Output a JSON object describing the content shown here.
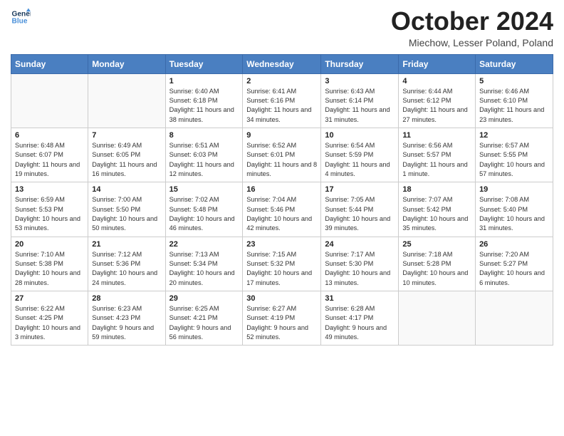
{
  "header": {
    "logo_line1": "General",
    "logo_line2": "Blue",
    "month_title": "October 2024",
    "subtitle": "Miechow, Lesser Poland, Poland"
  },
  "days_of_week": [
    "Sunday",
    "Monday",
    "Tuesday",
    "Wednesday",
    "Thursday",
    "Friday",
    "Saturday"
  ],
  "weeks": [
    [
      {
        "day": "",
        "sunrise": "",
        "sunset": "",
        "daylight": ""
      },
      {
        "day": "",
        "sunrise": "",
        "sunset": "",
        "daylight": ""
      },
      {
        "day": "1",
        "sunrise": "Sunrise: 6:40 AM",
        "sunset": "Sunset: 6:18 PM",
        "daylight": "Daylight: 11 hours and 38 minutes."
      },
      {
        "day": "2",
        "sunrise": "Sunrise: 6:41 AM",
        "sunset": "Sunset: 6:16 PM",
        "daylight": "Daylight: 11 hours and 34 minutes."
      },
      {
        "day": "3",
        "sunrise": "Sunrise: 6:43 AM",
        "sunset": "Sunset: 6:14 PM",
        "daylight": "Daylight: 11 hours and 31 minutes."
      },
      {
        "day": "4",
        "sunrise": "Sunrise: 6:44 AM",
        "sunset": "Sunset: 6:12 PM",
        "daylight": "Daylight: 11 hours and 27 minutes."
      },
      {
        "day": "5",
        "sunrise": "Sunrise: 6:46 AM",
        "sunset": "Sunset: 6:10 PM",
        "daylight": "Daylight: 11 hours and 23 minutes."
      }
    ],
    [
      {
        "day": "6",
        "sunrise": "Sunrise: 6:48 AM",
        "sunset": "Sunset: 6:07 PM",
        "daylight": "Daylight: 11 hours and 19 minutes."
      },
      {
        "day": "7",
        "sunrise": "Sunrise: 6:49 AM",
        "sunset": "Sunset: 6:05 PM",
        "daylight": "Daylight: 11 hours and 16 minutes."
      },
      {
        "day": "8",
        "sunrise": "Sunrise: 6:51 AM",
        "sunset": "Sunset: 6:03 PM",
        "daylight": "Daylight: 11 hours and 12 minutes."
      },
      {
        "day": "9",
        "sunrise": "Sunrise: 6:52 AM",
        "sunset": "Sunset: 6:01 PM",
        "daylight": "Daylight: 11 hours and 8 minutes."
      },
      {
        "day": "10",
        "sunrise": "Sunrise: 6:54 AM",
        "sunset": "Sunset: 5:59 PM",
        "daylight": "Daylight: 11 hours and 4 minutes."
      },
      {
        "day": "11",
        "sunrise": "Sunrise: 6:56 AM",
        "sunset": "Sunset: 5:57 PM",
        "daylight": "Daylight: 11 hours and 1 minute."
      },
      {
        "day": "12",
        "sunrise": "Sunrise: 6:57 AM",
        "sunset": "Sunset: 5:55 PM",
        "daylight": "Daylight: 10 hours and 57 minutes."
      }
    ],
    [
      {
        "day": "13",
        "sunrise": "Sunrise: 6:59 AM",
        "sunset": "Sunset: 5:53 PM",
        "daylight": "Daylight: 10 hours and 53 minutes."
      },
      {
        "day": "14",
        "sunrise": "Sunrise: 7:00 AM",
        "sunset": "Sunset: 5:50 PM",
        "daylight": "Daylight: 10 hours and 50 minutes."
      },
      {
        "day": "15",
        "sunrise": "Sunrise: 7:02 AM",
        "sunset": "Sunset: 5:48 PM",
        "daylight": "Daylight: 10 hours and 46 minutes."
      },
      {
        "day": "16",
        "sunrise": "Sunrise: 7:04 AM",
        "sunset": "Sunset: 5:46 PM",
        "daylight": "Daylight: 10 hours and 42 minutes."
      },
      {
        "day": "17",
        "sunrise": "Sunrise: 7:05 AM",
        "sunset": "Sunset: 5:44 PM",
        "daylight": "Daylight: 10 hours and 39 minutes."
      },
      {
        "day": "18",
        "sunrise": "Sunrise: 7:07 AM",
        "sunset": "Sunset: 5:42 PM",
        "daylight": "Daylight: 10 hours and 35 minutes."
      },
      {
        "day": "19",
        "sunrise": "Sunrise: 7:08 AM",
        "sunset": "Sunset: 5:40 PM",
        "daylight": "Daylight: 10 hours and 31 minutes."
      }
    ],
    [
      {
        "day": "20",
        "sunrise": "Sunrise: 7:10 AM",
        "sunset": "Sunset: 5:38 PM",
        "daylight": "Daylight: 10 hours and 28 minutes."
      },
      {
        "day": "21",
        "sunrise": "Sunrise: 7:12 AM",
        "sunset": "Sunset: 5:36 PM",
        "daylight": "Daylight: 10 hours and 24 minutes."
      },
      {
        "day": "22",
        "sunrise": "Sunrise: 7:13 AM",
        "sunset": "Sunset: 5:34 PM",
        "daylight": "Daylight: 10 hours and 20 minutes."
      },
      {
        "day": "23",
        "sunrise": "Sunrise: 7:15 AM",
        "sunset": "Sunset: 5:32 PM",
        "daylight": "Daylight: 10 hours and 17 minutes."
      },
      {
        "day": "24",
        "sunrise": "Sunrise: 7:17 AM",
        "sunset": "Sunset: 5:30 PM",
        "daylight": "Daylight: 10 hours and 13 minutes."
      },
      {
        "day": "25",
        "sunrise": "Sunrise: 7:18 AM",
        "sunset": "Sunset: 5:28 PM",
        "daylight": "Daylight: 10 hours and 10 minutes."
      },
      {
        "day": "26",
        "sunrise": "Sunrise: 7:20 AM",
        "sunset": "Sunset: 5:27 PM",
        "daylight": "Daylight: 10 hours and 6 minutes."
      }
    ],
    [
      {
        "day": "27",
        "sunrise": "Sunrise: 6:22 AM",
        "sunset": "Sunset: 4:25 PM",
        "daylight": "Daylight: 10 hours and 3 minutes."
      },
      {
        "day": "28",
        "sunrise": "Sunrise: 6:23 AM",
        "sunset": "Sunset: 4:23 PM",
        "daylight": "Daylight: 9 hours and 59 minutes."
      },
      {
        "day": "29",
        "sunrise": "Sunrise: 6:25 AM",
        "sunset": "Sunset: 4:21 PM",
        "daylight": "Daylight: 9 hours and 56 minutes."
      },
      {
        "day": "30",
        "sunrise": "Sunrise: 6:27 AM",
        "sunset": "Sunset: 4:19 PM",
        "daylight": "Daylight: 9 hours and 52 minutes."
      },
      {
        "day": "31",
        "sunrise": "Sunrise: 6:28 AM",
        "sunset": "Sunset: 4:17 PM",
        "daylight": "Daylight: 9 hours and 49 minutes."
      },
      {
        "day": "",
        "sunrise": "",
        "sunset": "",
        "daylight": ""
      },
      {
        "day": "",
        "sunrise": "",
        "sunset": "",
        "daylight": ""
      }
    ]
  ]
}
